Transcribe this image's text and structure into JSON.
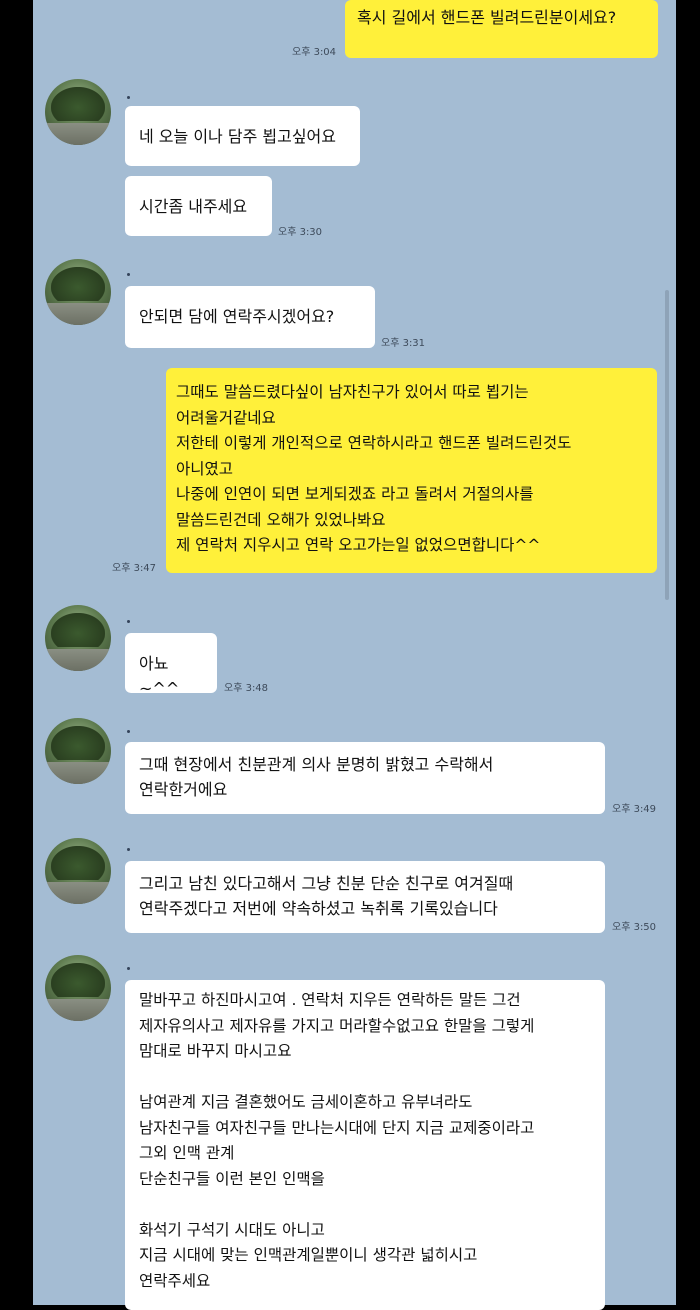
{
  "messages": [
    {
      "text": "혹시 길에서 핸드폰 빌려드린분이세요?",
      "time": "오후 3:04"
    },
    {
      "text": "네 오늘 이나 담주 뵙고싶어요"
    },
    {
      "text": "시간좀 내주세요",
      "time": "오후 3:30"
    },
    {
      "text": "안되면 담에 연락주시겠어요?",
      "time": "오후 3:31"
    },
    {
      "text": "그때도 말씀드렸다싶이 남자친구가 있어서 따로 뵙기는\n어려울거같네요\n저한테 이렇게 개인적으로 연락하시라고 핸드폰 빌려드린것도\n아니였고\n나중에 인연이 되면 보게되겠죠 라고 돌려서 거절의사를\n말씀드린건데 오해가 있었나봐요\n제 연락처 지우시고 연락 오고가는일 없었으면합니다^^",
      "time": "오후 3:47"
    },
    {
      "text": "아뇨 ~^^",
      "time": "오후 3:48"
    },
    {
      "text": "그때 현장에서 친분관계 의사 분명히 밝혔고 수락해서\n연락한거에요",
      "time": "오후 3:49"
    },
    {
      "text": "그리고 남친 있다고해서 그냥 친분 단순 친구로 여겨질때\n연락주겠다고 저번에 약속하셨고 녹취록 기록있습니다",
      "time": "오후 3:50"
    },
    {
      "text": "말바꾸고 하진마시고여 . 연락처 지우든 연락하든 말든 그건\n제자유의사고 제자유를 가지고 머라할수없고요 한말을 그렇게\n맘대로 바꾸지 마시고요\n\n남여관계 지금 결혼했어도 금세이혼하고 유부녀라도\n남자친구들 여자친구들 만나는시대에 단지 지금 교제중이라고\n그외 인맥 관계\n단순친구들 이런 본인 인맥을\n\n화석기 구석기 시대도 아니고\n지금 시대에 맞는 인맥관계일뿐이니 생각관 넓히시고\n연락주세요"
    }
  ]
}
